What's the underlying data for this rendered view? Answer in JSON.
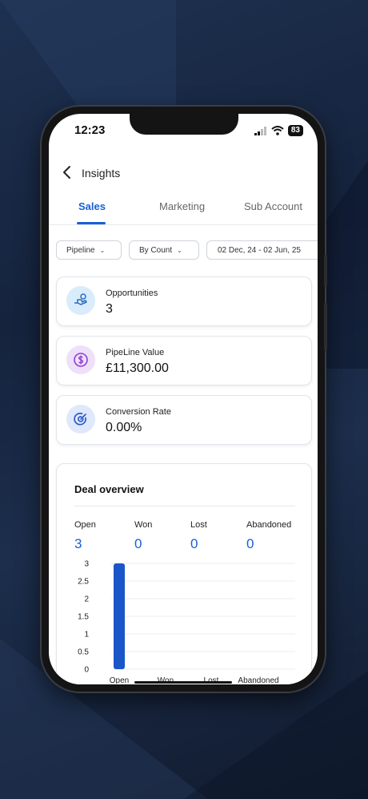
{
  "status": {
    "time": "12:23",
    "battery": "83"
  },
  "header": {
    "title": "Insights"
  },
  "tabs": [
    {
      "label": "Sales",
      "active": true
    },
    {
      "label": "Marketing",
      "active": false
    },
    {
      "label": "Sub Account",
      "active": false
    }
  ],
  "filters": {
    "pipeline": "Pipeline",
    "count": "By Count",
    "date_range": "02 Dec, 24 - 02 Jun, 25"
  },
  "metrics": [
    {
      "label": "Opportunities",
      "value": "3",
      "icon": "hand-money-icon",
      "color": "#d9ecfb"
    },
    {
      "label": "PipeLine Value",
      "value": "£11,300.00",
      "icon": "dollar-circle-icon",
      "color": "#efe0fa"
    },
    {
      "label": "Conversion Rate",
      "value": "0.00%",
      "icon": "target-icon",
      "color": "#e0e8fb"
    }
  ],
  "deal_overview": {
    "title": "Deal overview",
    "stats": [
      {
        "label": "Open",
        "value": "3"
      },
      {
        "label": "Won",
        "value": "0"
      },
      {
        "label": "Lost",
        "value": "0"
      },
      {
        "label": "Abandoned",
        "value": "0"
      }
    ]
  },
  "chart_data": {
    "type": "bar",
    "categories": [
      "Open",
      "Won",
      "Lost",
      "Abandoned"
    ],
    "values": [
      3,
      0,
      0,
      0
    ],
    "yticks": [
      "0",
      "0.5",
      "1",
      "1.5",
      "2",
      "2.5",
      "3"
    ],
    "ylim": [
      0,
      3
    ],
    "grid": true,
    "bar_color": "#1a56c8"
  },
  "colors": {
    "accent": "#1a5fd6"
  }
}
